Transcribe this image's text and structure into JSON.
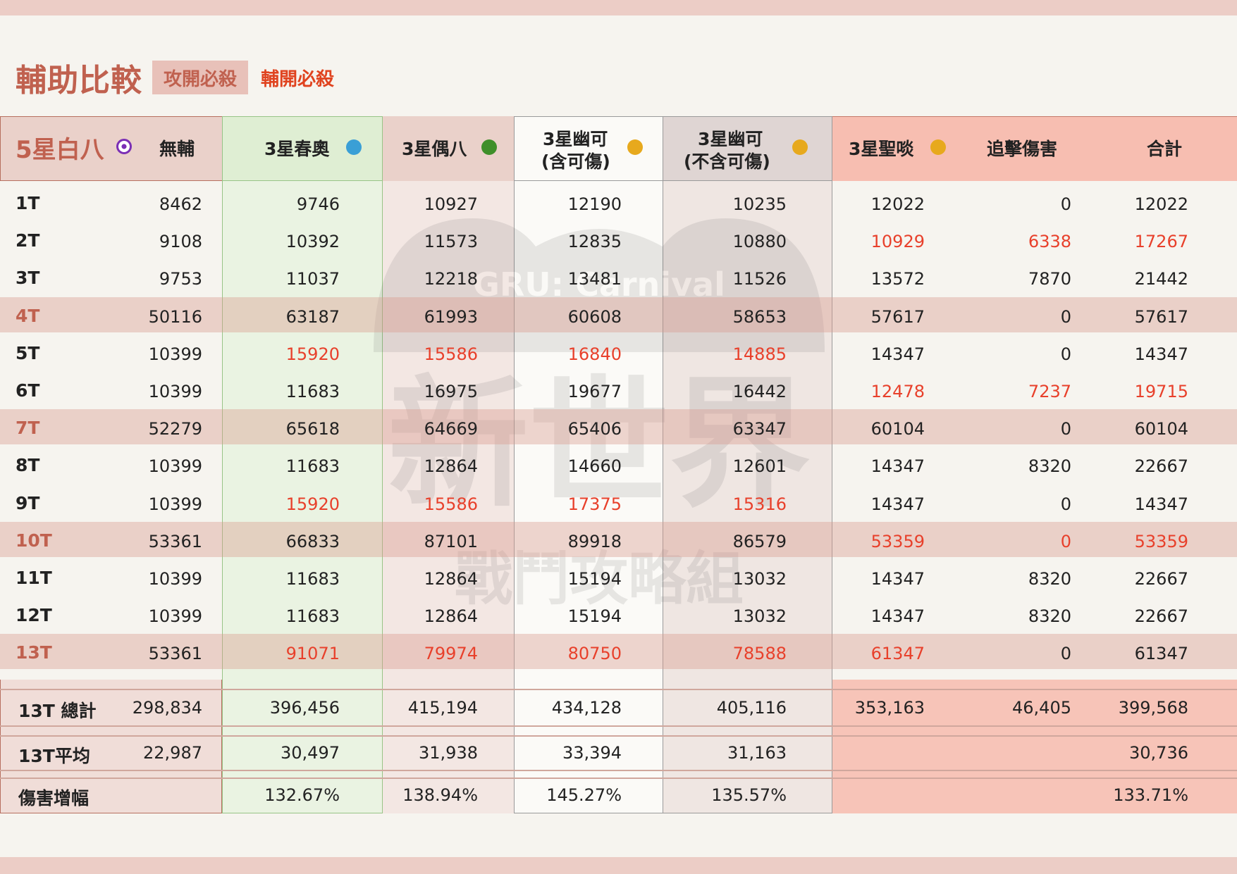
{
  "header": {
    "title": "輔助比較",
    "chip": "攻開必殺",
    "chip2": "輔開必殺"
  },
  "columns": {
    "base_name": "5星白八",
    "no_support": "無輔",
    "chun": "3星春奧",
    "ou": "3星偶八",
    "you1_line1": "3星幽可",
    "you1_line2": "(含可傷)",
    "you2_line1": "3星幽可",
    "you2_line2": "(不含可傷)",
    "sheng": "3星聖啖",
    "chase": "追擊傷害",
    "total": "合計"
  },
  "icon_colors": {
    "base": "#7b2fb5",
    "chun": "#3a9fd6",
    "ou": "#3f8f2a",
    "you": "#e7a91d",
    "sheng": "#e7a91d"
  },
  "watermark": {
    "line1": "新世界",
    "line2": "戰鬥攻略組",
    "line3": "GRU: Carnival"
  },
  "rows": [
    {
      "label": "1T",
      "v": [
        "8462",
        "9746",
        "10927",
        "12190",
        "10235",
        "12022",
        "0",
        "12022"
      ]
    },
    {
      "label": "2T",
      "v": [
        "9108",
        "10392",
        "11573",
        "12835",
        "10880",
        "10929",
        "6338",
        "17267"
      ]
    },
    {
      "label": "3T",
      "v": [
        "9753",
        "11037",
        "12218",
        "13481",
        "11526",
        "13572",
        "7870",
        "21442"
      ]
    },
    {
      "label": "4T",
      "v": [
        "50116",
        "63187",
        "61993",
        "60608",
        "58653",
        "57617",
        "0",
        "57617"
      ]
    },
    {
      "label": "5T",
      "v": [
        "10399",
        "15920",
        "15586",
        "16840",
        "14885",
        "14347",
        "0",
        "14347"
      ]
    },
    {
      "label": "6T",
      "v": [
        "10399",
        "11683",
        "16975",
        "19677",
        "16442",
        "12478",
        "7237",
        "19715"
      ]
    },
    {
      "label": "7T",
      "v": [
        "52279",
        "65618",
        "64669",
        "65406",
        "63347",
        "60104",
        "0",
        "60104"
      ]
    },
    {
      "label": "8T",
      "v": [
        "10399",
        "11683",
        "12864",
        "14660",
        "12601",
        "14347",
        "8320",
        "22667"
      ]
    },
    {
      "label": "9T",
      "v": [
        "10399",
        "15920",
        "15586",
        "17375",
        "15316",
        "14347",
        "0",
        "14347"
      ]
    },
    {
      "label": "10T",
      "v": [
        "53361",
        "66833",
        "87101",
        "89918",
        "86579",
        "53359",
        "0",
        "53359"
      ]
    },
    {
      "label": "11T",
      "v": [
        "10399",
        "11683",
        "12864",
        "15194",
        "13032",
        "14347",
        "8320",
        "22667"
      ]
    },
    {
      "label": "12T",
      "v": [
        "10399",
        "11683",
        "12864",
        "15194",
        "13032",
        "14347",
        "8320",
        "22667"
      ]
    },
    {
      "label": "13T",
      "v": [
        "53361",
        "91071",
        "79974",
        "80750",
        "78588",
        "61347",
        "0",
        "61347"
      ]
    }
  ],
  "totals": [
    {
      "label": "13T 總計",
      "v": [
        "298,834",
        "396,456",
        "415,194",
        "434,128",
        "405,116",
        "353,163",
        "46,405",
        "399,568"
      ]
    },
    {
      "label": "13T平均",
      "v": [
        "22,987",
        "30,497",
        "31,938",
        "33,394",
        "31,163",
        "",
        "",
        "30,736"
      ]
    },
    {
      "label": "傷害增幅",
      "v": [
        "",
        "132.67%",
        "138.94%",
        "145.27%",
        "135.57%",
        "",
        "",
        "133.71%"
      ]
    }
  ]
}
